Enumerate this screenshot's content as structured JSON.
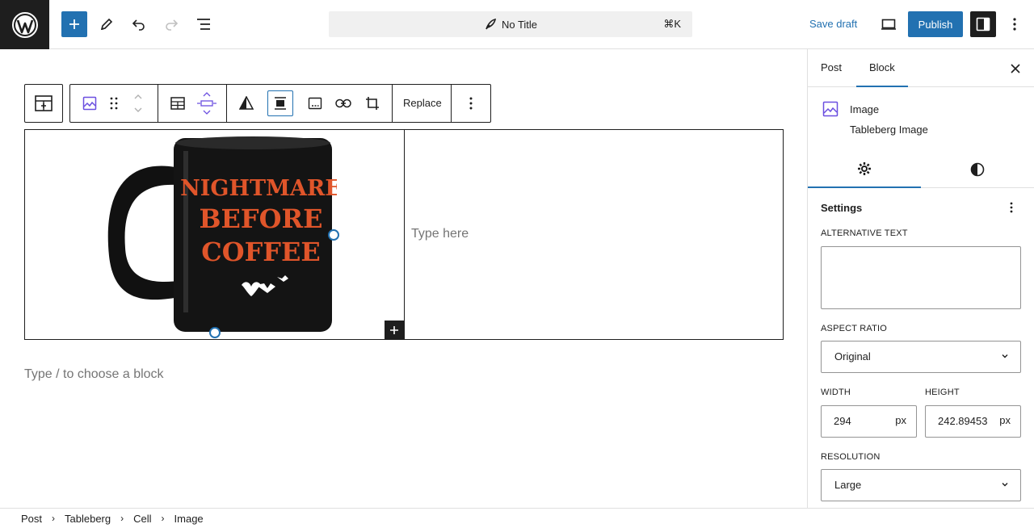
{
  "topbar": {
    "doc_title": "No Title",
    "shortcut": "⌘K",
    "save_draft": "Save draft",
    "publish": "Publish"
  },
  "toolbar": {
    "replace": "Replace"
  },
  "table": {
    "cell_placeholder": "Type here",
    "mug_text": [
      "NIGHTMARE",
      "BEFORE",
      "COFFEE"
    ]
  },
  "editor": {
    "block_placeholder": "Type / to choose a block"
  },
  "sidebar": {
    "tabs": [
      "Post",
      "Block"
    ],
    "block_name": "Image",
    "block_desc": "Tableberg Image",
    "settings_heading": "Settings",
    "alt_label": "ALTERNATIVE TEXT",
    "alt_value": "",
    "aspect_label": "ASPECT RATIO",
    "aspect_value": "Original",
    "width_label": "WIDTH",
    "width_value": "294",
    "height_label": "HEIGHT",
    "height_value": "242.89453",
    "unit": "px",
    "resolution_label": "RESOLUTION",
    "resolution_value": "Large"
  },
  "breadcrumb": [
    "Post",
    "Tableberg",
    "Cell",
    "Image"
  ],
  "colors": {
    "accent": "#2271b1",
    "dark": "#1e1e1e",
    "mug_text": "#e0552a"
  }
}
